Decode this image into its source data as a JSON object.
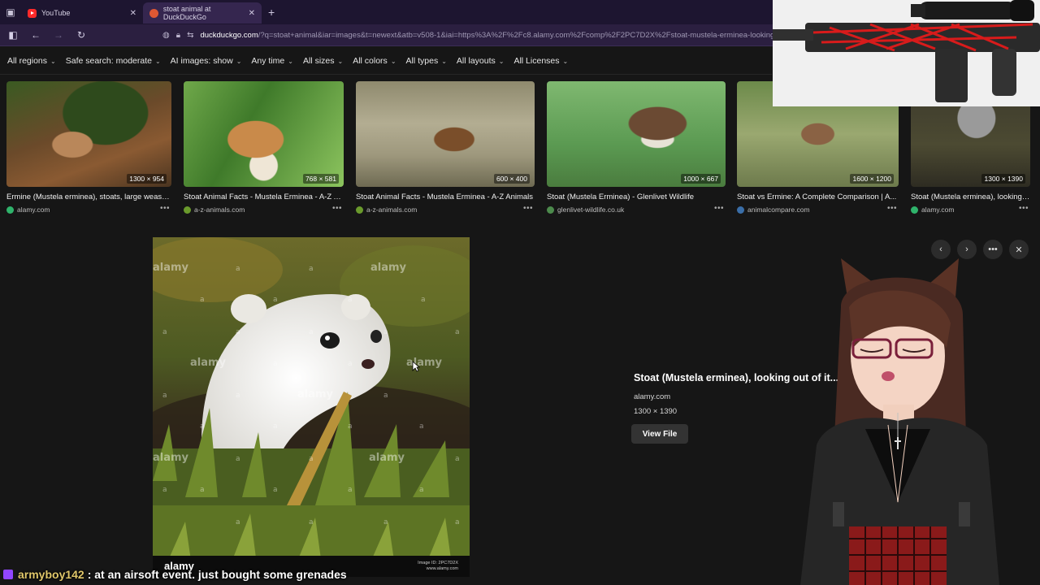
{
  "browser": {
    "tabs": [
      {
        "label": "YouTube",
        "active": false
      },
      {
        "label": "stoat animal at DuckDuckGo",
        "active": true
      }
    ],
    "url_host": "duckduckgo.com",
    "url_rest": "/?q=stoat+animal&iar=images&t=newext&atb=v508-1&iai=https%3A%2F%2Fc8.alamy.com%2Fcomp%2F2PC7D2X%2Fstoat-mustela-erminea-looking-out-of"
  },
  "filters": [
    "All regions",
    "Safe search: moderate",
    "AI images: show",
    "Any time",
    "All sizes",
    "All colors",
    "All types",
    "All layouts",
    "All Licenses"
  ],
  "thumbnails": [
    {
      "dims": "1300 × 954",
      "title": "Ermine (Mustela erminea), stoats, large weasel...",
      "source": "alamy.com",
      "icon_color": "#2fb36b"
    },
    {
      "dims": "768 × 581",
      "title": "Stoat Animal Facts - Mustela Erminea - A-Z A...",
      "source": "a-z-animals.com",
      "icon_color": "#6a9a2c"
    },
    {
      "dims": "600 × 400",
      "title": "Stoat Animal Facts - Mustela Erminea - A-Z Animals",
      "source": "a-z-animals.com",
      "icon_color": "#6a9a2c"
    },
    {
      "dims": "1000 × 667",
      "title": "Stoat (Mustela Erminea) - Glenlivet Wildlife",
      "source": "glenlivet-wildlife.co.uk",
      "icon_color": "#4c8a4c"
    },
    {
      "dims": "1600 × 1200",
      "title": "Stoat vs Ermine: A Complete Comparison | A...",
      "source": "animalcompare.com",
      "icon_color": "#3a6ea8"
    },
    {
      "dims": "1300 × 1390",
      "title": "Stoat (Mustela erminea), looking ...",
      "source": "alamy.com",
      "icon_color": "#2fb36b"
    }
  ],
  "detail": {
    "title": "Stoat (Mustela erminea), looking out of it... ow, animal ...",
    "source": "alamy.com",
    "dims": "1300 × 1390",
    "view_button": "View File",
    "image_brand": "alamy",
    "image_id": "Image ID: 2PC7D2X",
    "image_site": "www.alamy.com"
  },
  "chat": {
    "user": "armyboy142",
    "message": ": at an airsoft event. just bought some grenades"
  }
}
